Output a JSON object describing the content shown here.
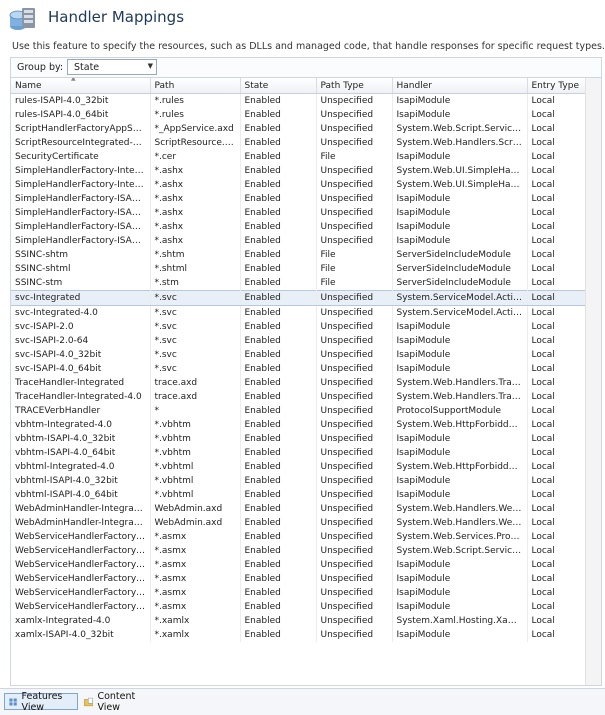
{
  "header": {
    "title": "Handler Mappings",
    "icon": "handler-mappings-icon"
  },
  "description": "Use this feature to specify the resources, such as DLLs and managed code, that handle responses for specific request types.",
  "groupby": {
    "label": "Group by:",
    "value": "State"
  },
  "table": {
    "columns": [
      "Name",
      "Path",
      "State",
      "Path Type",
      "Handler",
      "Entry Type"
    ],
    "selected_row": 14,
    "rows": [
      [
        "rules-ISAPI-4.0_32bit",
        "*.rules",
        "Enabled",
        "Unspecified",
        "IsapiModule",
        "Local"
      ],
      [
        "rules-ISAPI-4.0_64bit",
        "*.rules",
        "Enabled",
        "Unspecified",
        "IsapiModule",
        "Local"
      ],
      [
        "ScriptHandlerFactoryAppServi...",
        "*_AppService.axd",
        "Enabled",
        "Unspecified",
        "System.Web.Script.Services.S...",
        "Local"
      ],
      [
        "ScriptResourceIntegrated-4.0",
        "ScriptResource.axd",
        "Enabled",
        "Unspecified",
        "System.Web.Handlers.ScriptR...",
        "Local"
      ],
      [
        "SecurityCertificate",
        "*.cer",
        "Enabled",
        "File",
        "IsapiModule",
        "Local"
      ],
      [
        "SimpleHandlerFactory-Integra...",
        "*.ashx",
        "Enabled",
        "Unspecified",
        "System.Web.UI.SimpleHandle...",
        "Local"
      ],
      [
        "SimpleHandlerFactory-Integra...",
        "*.ashx",
        "Enabled",
        "Unspecified",
        "System.Web.UI.SimpleHandle...",
        "Local"
      ],
      [
        "SimpleHandlerFactory-ISAPI-2.0",
        "*.ashx",
        "Enabled",
        "Unspecified",
        "IsapiModule",
        "Local"
      ],
      [
        "SimpleHandlerFactory-ISAPI-2...",
        "*.ashx",
        "Enabled",
        "Unspecified",
        "IsapiModule",
        "Local"
      ],
      [
        "SimpleHandlerFactory-ISAPI-4...",
        "*.ashx",
        "Enabled",
        "Unspecified",
        "IsapiModule",
        "Local"
      ],
      [
        "SimpleHandlerFactory-ISAPI-4...",
        "*.ashx",
        "Enabled",
        "Unspecified",
        "IsapiModule",
        "Local"
      ],
      [
        "SSINC-shtm",
        "*.shtm",
        "Enabled",
        "File",
        "ServerSideIncludeModule",
        "Local"
      ],
      [
        "SSINC-shtml",
        "*.shtml",
        "Enabled",
        "File",
        "ServerSideIncludeModule",
        "Local"
      ],
      [
        "SSINC-stm",
        "*.stm",
        "Enabled",
        "File",
        "ServerSideIncludeModule",
        "Local"
      ],
      [
        "svc-Integrated",
        "*.svc",
        "Enabled",
        "Unspecified",
        "System.ServiceModel.Activati...",
        "Local"
      ],
      [
        "svc-Integrated-4.0",
        "*.svc",
        "Enabled",
        "Unspecified",
        "System.ServiceModel.Activati...",
        "Local"
      ],
      [
        "svc-ISAPI-2.0",
        "*.svc",
        "Enabled",
        "Unspecified",
        "IsapiModule",
        "Local"
      ],
      [
        "svc-ISAPI-2.0-64",
        "*.svc",
        "Enabled",
        "Unspecified",
        "IsapiModule",
        "Local"
      ],
      [
        "svc-ISAPI-4.0_32bit",
        "*.svc",
        "Enabled",
        "Unspecified",
        "IsapiModule",
        "Local"
      ],
      [
        "svc-ISAPI-4.0_64bit",
        "*.svc",
        "Enabled",
        "Unspecified",
        "IsapiModule",
        "Local"
      ],
      [
        "TraceHandler-Integrated",
        "trace.axd",
        "Enabled",
        "Unspecified",
        "System.Web.Handlers.TraceH...",
        "Local"
      ],
      [
        "TraceHandler-Integrated-4.0",
        "trace.axd",
        "Enabled",
        "Unspecified",
        "System.Web.Handlers.TraceH...",
        "Local"
      ],
      [
        "TRACEVerbHandler",
        "*",
        "Enabled",
        "Unspecified",
        "ProtocolSupportModule",
        "Local"
      ],
      [
        "vbhtm-Integrated-4.0",
        "*.vbhtm",
        "Enabled",
        "Unspecified",
        "System.Web.HttpForbiddenH...",
        "Local"
      ],
      [
        "vbhtm-ISAPI-4.0_32bit",
        "*.vbhtm",
        "Enabled",
        "Unspecified",
        "IsapiModule",
        "Local"
      ],
      [
        "vbhtm-ISAPI-4.0_64bit",
        "*.vbhtm",
        "Enabled",
        "Unspecified",
        "IsapiModule",
        "Local"
      ],
      [
        "vbhtml-Integrated-4.0",
        "*.vbhtml",
        "Enabled",
        "Unspecified",
        "System.Web.HttpForbiddenH...",
        "Local"
      ],
      [
        "vbhtml-ISAPI-4.0_32bit",
        "*.vbhtml",
        "Enabled",
        "Unspecified",
        "IsapiModule",
        "Local"
      ],
      [
        "vbhtml-ISAPI-4.0_64bit",
        "*.vbhtml",
        "Enabled",
        "Unspecified",
        "IsapiModule",
        "Local"
      ],
      [
        "WebAdminHandler-Integrated",
        "WebAdmin.axd",
        "Enabled",
        "Unspecified",
        "System.Web.Handlers.WebAd...",
        "Local"
      ],
      [
        "WebAdminHandler-Integrated...",
        "WebAdmin.axd",
        "Enabled",
        "Unspecified",
        "System.Web.Handlers.WebAd...",
        "Local"
      ],
      [
        "WebServiceHandlerFactory-Int...",
        "*.asmx",
        "Enabled",
        "Unspecified",
        "System.Web.Services.Protoco...",
        "Local"
      ],
      [
        "WebServiceHandlerFactory-Int...",
        "*.asmx",
        "Enabled",
        "Unspecified",
        "System.Web.Script.Services.S...",
        "Local"
      ],
      [
        "WebServiceHandlerFactory-IS...",
        "*.asmx",
        "Enabled",
        "Unspecified",
        "IsapiModule",
        "Local"
      ],
      [
        "WebServiceHandlerFactory-IS...",
        "*.asmx",
        "Enabled",
        "Unspecified",
        "IsapiModule",
        "Local"
      ],
      [
        "WebServiceHandlerFactory-IS...",
        "*.asmx",
        "Enabled",
        "Unspecified",
        "IsapiModule",
        "Local"
      ],
      [
        "WebServiceHandlerFactory-IS...",
        "*.asmx",
        "Enabled",
        "Unspecified",
        "IsapiModule",
        "Local"
      ],
      [
        "xamlx-Integrated-4.0",
        "*.xamlx",
        "Enabled",
        "Unspecified",
        "System.Xaml.Hosting.XamlHt...",
        "Local"
      ],
      [
        "xamlx-ISAPI-4.0_32bit",
        "*.xamlx",
        "Enabled",
        "Unspecified",
        "IsapiModule",
        "Local"
      ]
    ]
  },
  "footer": {
    "features_view": "Features View",
    "content_view": "Content View"
  }
}
